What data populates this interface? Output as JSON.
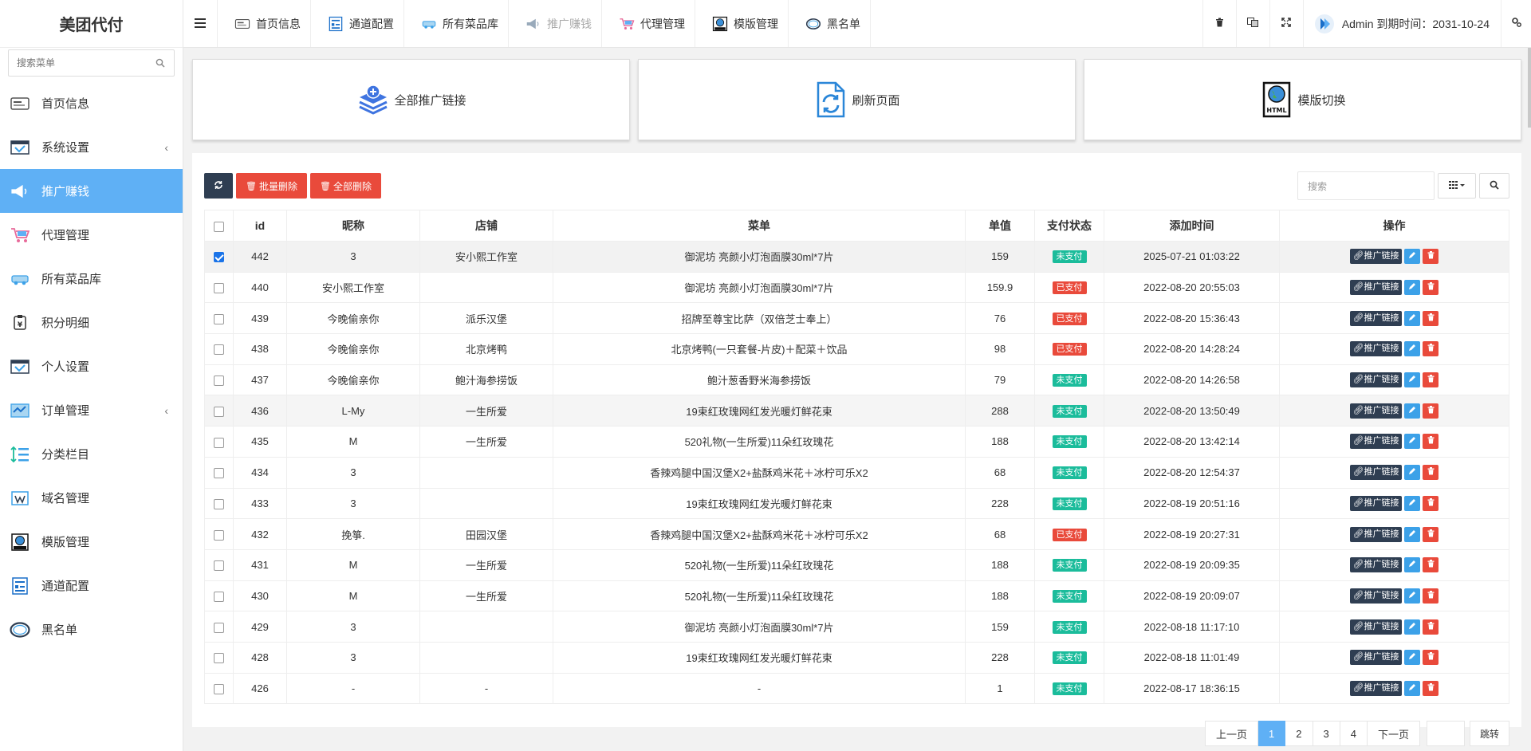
{
  "sidebar": {
    "logo": "美团代付",
    "search_placeholder": "搜索菜单",
    "items": [
      {
        "label": "首页信息",
        "icon": "monitor-icon"
      },
      {
        "label": "系统设置",
        "icon": "settings-panel-icon",
        "has_arrow": true
      },
      {
        "label": "推广赚钱",
        "icon": "megaphone-icon",
        "active": true
      },
      {
        "label": "代理管理",
        "icon": "cart-icon"
      },
      {
        "label": "所有菜品库",
        "icon": "car-icon"
      },
      {
        "label": "积分明细",
        "icon": "points-icon"
      },
      {
        "label": "个人设置",
        "icon": "user-settings-icon"
      },
      {
        "label": "订单管理",
        "icon": "order-icon",
        "has_arrow": true
      },
      {
        "label": "分类栏目",
        "icon": "category-icon"
      },
      {
        "label": "域名管理",
        "icon": "domain-icon"
      },
      {
        "label": "模版管理",
        "icon": "template-icon"
      },
      {
        "label": "通道配置",
        "icon": "channel-icon"
      },
      {
        "label": "黑名单",
        "icon": "blacklist-icon"
      }
    ],
    "arrow": "‹"
  },
  "topbar": {
    "tabs": [
      {
        "label": "首页信息"
      },
      {
        "label": "通道配置"
      },
      {
        "label": "所有菜品库"
      },
      {
        "label": "推广赚钱"
      },
      {
        "label": "代理管理"
      },
      {
        "label": "模版管理"
      },
      {
        "label": "黑名单"
      }
    ],
    "user_text": "Admin 到期时间：2031-10-24"
  },
  "cards": [
    {
      "label": "全部推广链接"
    },
    {
      "label": "刷新页面"
    },
    {
      "label": "模版切换"
    }
  ],
  "toolbar": {
    "batch_delete": "批量删除",
    "delete_all": "全部删除",
    "search_placeholder": "搜索"
  },
  "table": {
    "headers": [
      "id",
      "昵称",
      "店铺",
      "菜单",
      "单值",
      "支付状态",
      "添加时间",
      "操作"
    ],
    "rows": [
      {
        "id": "442",
        "nick": "3",
        "shop": "安小熙工作室",
        "menu": "御泥坊 亮颜小灯泡面膜30ml*7片",
        "price": "159",
        "status": "未支付",
        "paid": false,
        "time": "2025-07-21 01:03:22",
        "checked": true
      },
      {
        "id": "440",
        "nick": "安小熙工作室",
        "shop": "",
        "menu": "御泥坊 亮颜小灯泡面膜30ml*7片",
        "price": "159.9",
        "status": "已支付",
        "paid": true,
        "time": "2022-08-20 20:55:03"
      },
      {
        "id": "439",
        "nick": "今晚偷亲你",
        "shop": "派乐汉堡",
        "menu": "招牌至尊宝比萨（双倍芝士奉上）",
        "price": "76",
        "status": "已支付",
        "paid": true,
        "time": "2022-08-20 15:36:43"
      },
      {
        "id": "438",
        "nick": "今晚偷亲你",
        "shop": "北京烤鸭",
        "menu": "北京烤鸭(一只套餐-片皮)＋配菜＋饮品",
        "price": "98",
        "status": "已支付",
        "paid": true,
        "time": "2022-08-20 14:28:24"
      },
      {
        "id": "437",
        "nick": "今晚偷亲你",
        "shop": "鲍汁海参捞饭",
        "menu": "鲍汁葱香野米海参捞饭",
        "price": "79",
        "status": "未支付",
        "paid": false,
        "time": "2022-08-20 14:26:58"
      },
      {
        "id": "436",
        "nick": "L-My",
        "shop": "一生所爱",
        "menu": "19束红玫瑰网红发光暖灯鲜花束",
        "price": "288",
        "status": "未支付",
        "paid": false,
        "time": "2022-08-20 13:50:49",
        "hover": true
      },
      {
        "id": "435",
        "nick": "M",
        "shop": "一生所爱",
        "menu": "520礼物(一生所爱)11朵红玫瑰花",
        "price": "188",
        "status": "未支付",
        "paid": false,
        "time": "2022-08-20 13:42:14"
      },
      {
        "id": "434",
        "nick": "3",
        "shop": "",
        "menu": "香辣鸡腿中国汉堡X2+盐酥鸡米花＋冰柠可乐X2",
        "price": "68",
        "status": "未支付",
        "paid": false,
        "time": "2022-08-20 12:54:37"
      },
      {
        "id": "433",
        "nick": "3",
        "shop": "",
        "menu": "19束红玫瑰网红发光暖灯鲜花束",
        "price": "228",
        "status": "未支付",
        "paid": false,
        "time": "2022-08-19 20:51:16"
      },
      {
        "id": "432",
        "nick": "挽箏.",
        "shop": "田园汉堡",
        "menu": "香辣鸡腿中国汉堡X2+盐酥鸡米花＋冰柠可乐X2",
        "price": "68",
        "status": "已支付",
        "paid": true,
        "time": "2022-08-19 20:27:31"
      },
      {
        "id": "431",
        "nick": "M",
        "shop": "一生所爱",
        "menu": "520礼物(一生所爱)11朵红玫瑰花",
        "price": "188",
        "status": "未支付",
        "paid": false,
        "time": "2022-08-19 20:09:35"
      },
      {
        "id": "430",
        "nick": "M",
        "shop": "一生所爱",
        "menu": "520礼物(一生所爱)11朵红玫瑰花",
        "price": "188",
        "status": "未支付",
        "paid": false,
        "time": "2022-08-19 20:09:07"
      },
      {
        "id": "429",
        "nick": "3",
        "shop": "",
        "menu": "御泥坊 亮颜小灯泡面膜30ml*7片",
        "price": "159",
        "status": "未支付",
        "paid": false,
        "time": "2022-08-18 11:17:10"
      },
      {
        "id": "428",
        "nick": "3",
        "shop": "",
        "menu": "19束红玫瑰网红发光暖灯鲜花束",
        "price": "228",
        "status": "未支付",
        "paid": false,
        "time": "2022-08-18 11:01:49"
      },
      {
        "id": "426",
        "nick": "-",
        "shop": "-",
        "menu": "-",
        "price": "1",
        "status": "未支付",
        "paid": false,
        "time": "2022-08-17 18:36:15"
      }
    ],
    "op_link_label": "推广链接"
  },
  "pager": {
    "prev": "上一页",
    "pages": [
      "1",
      "2",
      "3",
      "4"
    ],
    "current": "1",
    "next": "下一页",
    "go": "跳转"
  },
  "colors": {
    "accent": "#5fb0f5",
    "dark": "#2f3e52",
    "danger": "#e94a3b",
    "success": "#1bbc9b"
  }
}
